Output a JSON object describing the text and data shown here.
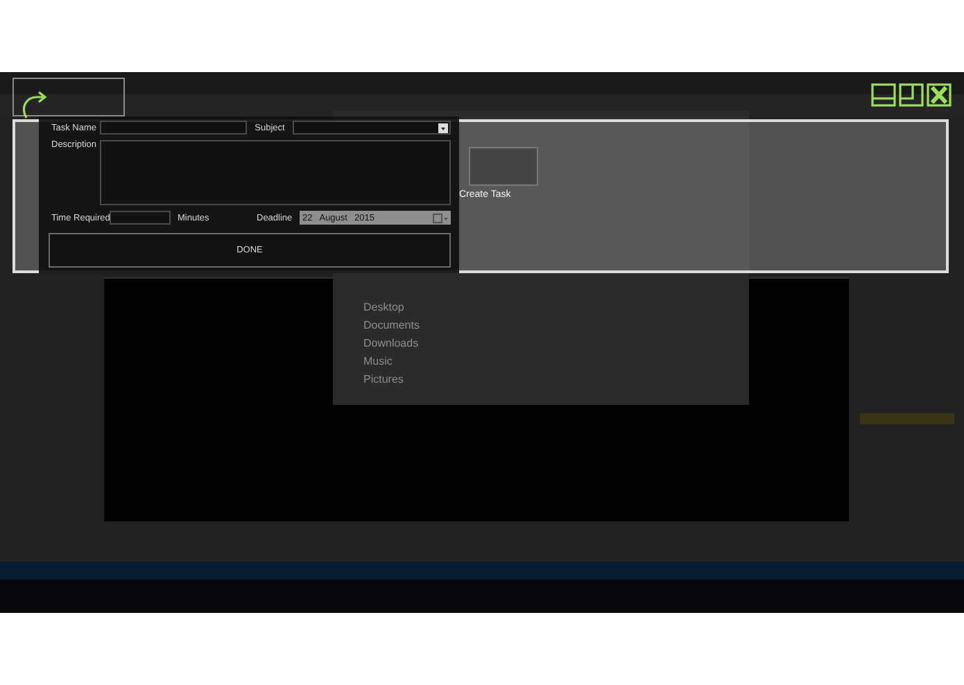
{
  "desktop": {
    "explorer": {
      "nav_items": [
        "Desktop",
        "Documents",
        "Downloads",
        "Music",
        "Pictures"
      ]
    },
    "file_label": "Create Task"
  },
  "task_form": {
    "task_name": {
      "label": "Task Name"
    },
    "subject": {
      "label": "Subject"
    },
    "description": {
      "label": "Description"
    },
    "time_required": {
      "label": "Time Required",
      "unit": "Minutes"
    },
    "deadline": {
      "label": "Deadline",
      "day": "22",
      "month": "August",
      "year": "2015"
    },
    "done_button": "DONE"
  }
}
